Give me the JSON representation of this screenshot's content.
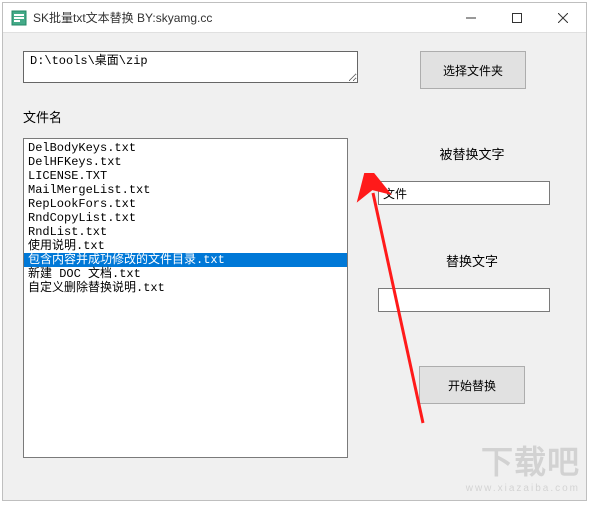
{
  "window": {
    "title": "SK批量txt文本替换 BY:skyamg.cc"
  },
  "path": {
    "value": "D:\\tools\\桌面\\zip"
  },
  "buttons": {
    "select_folder": "选择文件夹",
    "start_replace": "开始替换"
  },
  "labels": {
    "file_name": "文件名",
    "replaced_text": "被替换文字",
    "replace_text": "替换文字"
  },
  "inputs": {
    "replaced_value": "文件",
    "replace_value": ""
  },
  "file_list": {
    "selected_index": 8,
    "items": [
      "DelBodyKeys.txt",
      "DelHFKeys.txt",
      "LICENSE.TXT",
      "MailMergeList.txt",
      "RepLookFors.txt",
      "RndCopyList.txt",
      "RndList.txt",
      "使用说明.txt",
      "包含内容并成功修改的文件目录.txt",
      "新建 DOC 文档.txt",
      "自定义删除替换说明.txt"
    ]
  },
  "watermark": {
    "line1": "下载吧",
    "line2": "www.xiazaiba.com"
  }
}
